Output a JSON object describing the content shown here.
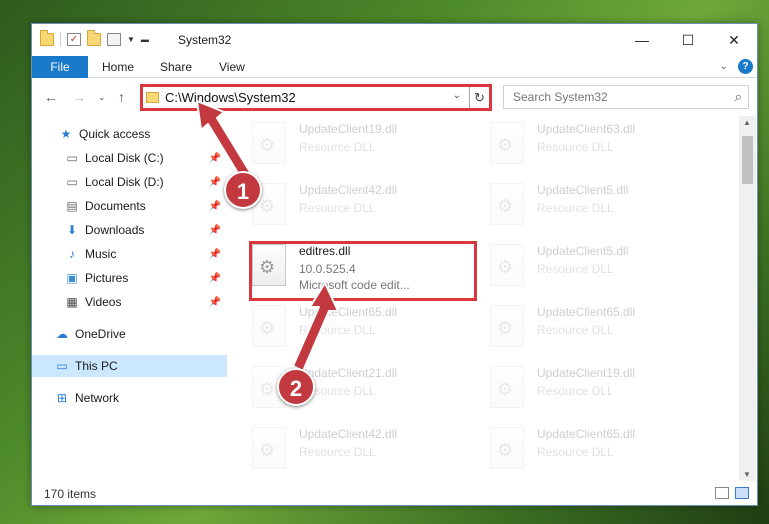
{
  "window": {
    "title": "System32",
    "controls": {
      "minimize": "—",
      "maximize": "☐",
      "close": "✕"
    }
  },
  "ribbon": {
    "tabs": [
      "File",
      "Home",
      "Share",
      "View"
    ],
    "help": "?"
  },
  "nav": {
    "address": "C:\\Windows\\System32",
    "search_placeholder": "Search System32"
  },
  "sidebar": {
    "items": [
      {
        "label": "Quick access",
        "icon": "star-icon",
        "pinned": false
      },
      {
        "label": "Local Disk (C:)",
        "icon": "drive-icon",
        "pinned": true
      },
      {
        "label": "Local Disk (D:)",
        "icon": "drive-icon",
        "pinned": true
      },
      {
        "label": "Documents",
        "icon": "document-icon",
        "pinned": true
      },
      {
        "label": "Downloads",
        "icon": "download-icon",
        "pinned": true
      },
      {
        "label": "Music",
        "icon": "music-icon",
        "pinned": true
      },
      {
        "label": "Pictures",
        "icon": "pictures-icon",
        "pinned": true
      },
      {
        "label": "Videos",
        "icon": "video-icon",
        "pinned": true
      },
      {
        "label": "OneDrive",
        "icon": "cloud-icon",
        "pinned": false
      },
      {
        "label": "This PC",
        "icon": "computer-icon",
        "pinned": false,
        "selected": true
      },
      {
        "label": "Network",
        "icon": "network-icon",
        "pinned": false
      }
    ]
  },
  "files": [
    {
      "name": "UpdateClient19.dll",
      "line2": "Resource DLL",
      "line3": ""
    },
    {
      "name": "UpdateClient63.dll",
      "line2": "Resource DLL",
      "line3": ""
    },
    {
      "name": "UpdateClient42.dll",
      "line2": "Resource DLL",
      "line3": ""
    },
    {
      "name": "UpdateClient5.dll",
      "line2": "Resource DLL",
      "line3": ""
    },
    {
      "name": "editres.dll",
      "line2": "10.0.525.4",
      "line3": "Microsoft code edit...",
      "highlighted": true
    },
    {
      "name": "UpdateClient5.dll",
      "line2": "Resource DLL",
      "line3": ""
    },
    {
      "name": "UpdateClient65.dll",
      "line2": "Resource DLL",
      "line3": ""
    },
    {
      "name": "UpdateClient65.dll",
      "line2": "Resource DLL",
      "line3": ""
    },
    {
      "name": "UpdateClient21.dll",
      "line2": "Resource DLL",
      "line3": ""
    },
    {
      "name": "UpdateClient19.dll",
      "line2": "Resource DLL",
      "line3": ""
    },
    {
      "name": "UpdateClient42.dll",
      "line2": "Resource DLL",
      "line3": ""
    },
    {
      "name": "UpdateClient65.dll",
      "line2": "Resource DLL",
      "line3": ""
    }
  ],
  "status": {
    "item_count": "170 items"
  },
  "callouts": [
    "1",
    "2"
  ],
  "colors": {
    "accent": "#1979ca",
    "callout": "#c2393f",
    "highlight_border": "#d9363e"
  }
}
